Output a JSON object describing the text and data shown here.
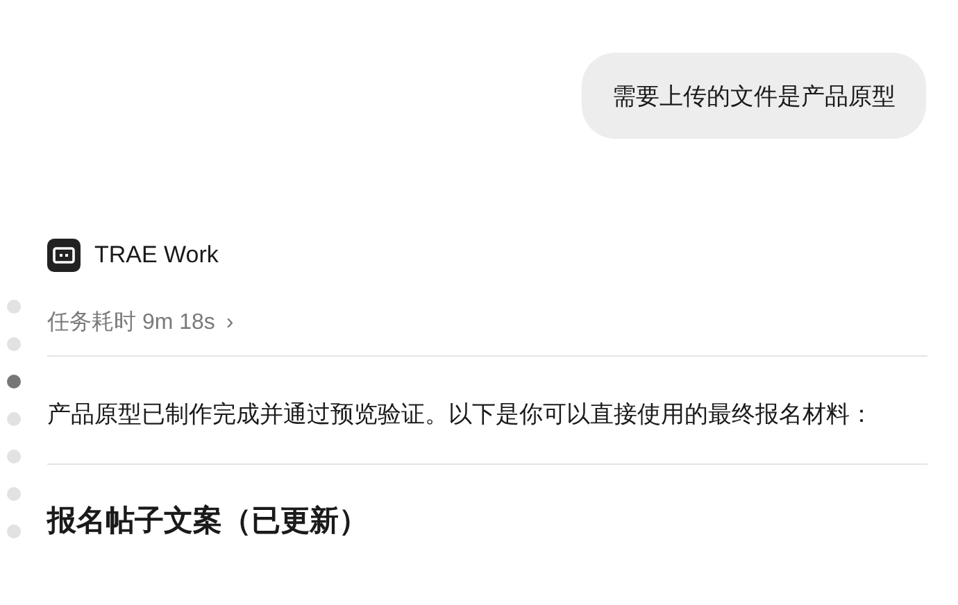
{
  "user_message": "需要上传的文件是产品原型",
  "assistant": {
    "name": "TRAE Work",
    "duration": "任务耗时 9m 18s",
    "duration_chevron": "›",
    "paragraph": "产品原型已制作完成并通过预览验证。以下是你可以直接使用的最终报名材料：",
    "heading": "报名帖子文案（已更新）"
  },
  "timeline_dots": [
    {
      "selected": false
    },
    {
      "selected": false
    },
    {
      "selected": true
    },
    {
      "selected": false
    },
    {
      "selected": false
    },
    {
      "selected": false
    },
    {
      "selected": false
    }
  ]
}
